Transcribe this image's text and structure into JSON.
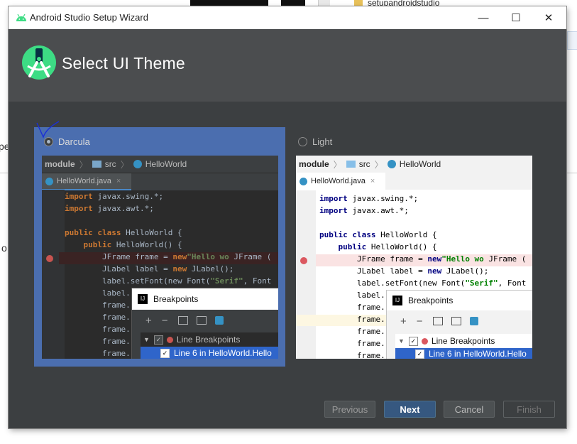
{
  "background": {
    "folder_label": "setupandroidstudio",
    "left_fragment_1": "ре",
    "left_fragment_2": "о"
  },
  "window": {
    "title": "Android Studio Setup Wizard",
    "controls": {
      "minimize": "—",
      "maximize": "☐",
      "close": "✕"
    }
  },
  "header": {
    "title": "Select UI Theme",
    "logo_icon": "android-studio-logo-icon"
  },
  "themes": [
    {
      "name": "Darcula",
      "selected": true,
      "breadcrumb": [
        "module",
        "src",
        "HelloWorld"
      ],
      "tab": "HelloWorld.java",
      "tab_close": "×",
      "code": [
        {
          "kw": "import",
          "rest": " javax.swing.*;"
        },
        {
          "kw": "import",
          "rest": " javax.awt.*;"
        },
        {
          "kw": "",
          "rest": ""
        },
        {
          "kw": "public class",
          "rest": " HelloWorld {"
        },
        {
          "kw": "    public",
          "rest": " HelloWorld() {"
        },
        {
          "kw": "",
          "rest": "        JFrame frame = ",
          "kw2": "new",
          "rest2": " JFrame (",
          "str": "\"Hello wo"
        },
        {
          "kw": "",
          "rest": "        JLabel label = ",
          "kw2": "new",
          "rest2": " JLabel();"
        },
        {
          "kw": "",
          "rest": "        label.setFont(new Font(",
          "str": "\"Serif\"",
          "rest2": ", Font"
        },
        {
          "kw": "",
          "rest": "        label."
        },
        {
          "kw": "",
          "rest": "        frame."
        },
        {
          "kw": "",
          "rest": "        frame."
        },
        {
          "kw": "",
          "rest": "        frame."
        },
        {
          "kw": "",
          "rest": "        frame."
        },
        {
          "kw": "",
          "rest": "        frame."
        }
      ],
      "popup": {
        "title": "Breakpoints",
        "toolbar": [
          "+",
          "−"
        ],
        "tree_root": "Line Breakpoints",
        "tree_child": "Line 6 in HelloWorld.Hello"
      }
    },
    {
      "name": "Light",
      "selected": false,
      "breadcrumb": [
        "module",
        "src",
        "HelloWorld"
      ],
      "tab": "HelloWorld.java",
      "tab_close": "×",
      "code": [
        {
          "kw": "import",
          "rest": " javax.swing.*;"
        },
        {
          "kw": "import",
          "rest": " javax.awt.*;"
        },
        {
          "kw": "",
          "rest": ""
        },
        {
          "kw": "public class",
          "rest": " HelloWorld {"
        },
        {
          "kw": "    public",
          "rest": " HelloWorld() {"
        },
        {
          "kw": "",
          "rest": "        JFrame frame = ",
          "kw2": "new",
          "rest2": " JFrame (",
          "str": "\"Hello wo"
        },
        {
          "kw": "",
          "rest": "        JLabel label = ",
          "kw2": "new",
          "rest2": " JLabel();"
        },
        {
          "kw": "",
          "rest": "        label.setFont(new Font(",
          "str": "\"Serif\"",
          "rest2": ", Font"
        },
        {
          "kw": "",
          "rest": "        label."
        },
        {
          "kw": "",
          "rest": "        frame."
        },
        {
          "kw": "",
          "rest": "        frame."
        },
        {
          "kw": "",
          "rest": "        frame."
        },
        {
          "kw": "",
          "rest": "        frame."
        },
        {
          "kw": "",
          "rest": "        frame."
        }
      ],
      "popup": {
        "title": "Breakpoints",
        "toolbar": [
          "+",
          "−"
        ],
        "tree_root": "Line Breakpoints",
        "tree_child": "Line 6 in HelloWorld.Hello"
      }
    }
  ],
  "footer": {
    "previous": "Previous",
    "next": "Next",
    "cancel": "Cancel",
    "finish": "Finish"
  },
  "colors": {
    "window_bg": "#3c3f41",
    "header_bg": "#4b4d4f",
    "selected_card": "#4b6eaf",
    "primary_button": "#365880",
    "breakpoint_red": "#c75450",
    "android_green": "#3ddc84"
  }
}
